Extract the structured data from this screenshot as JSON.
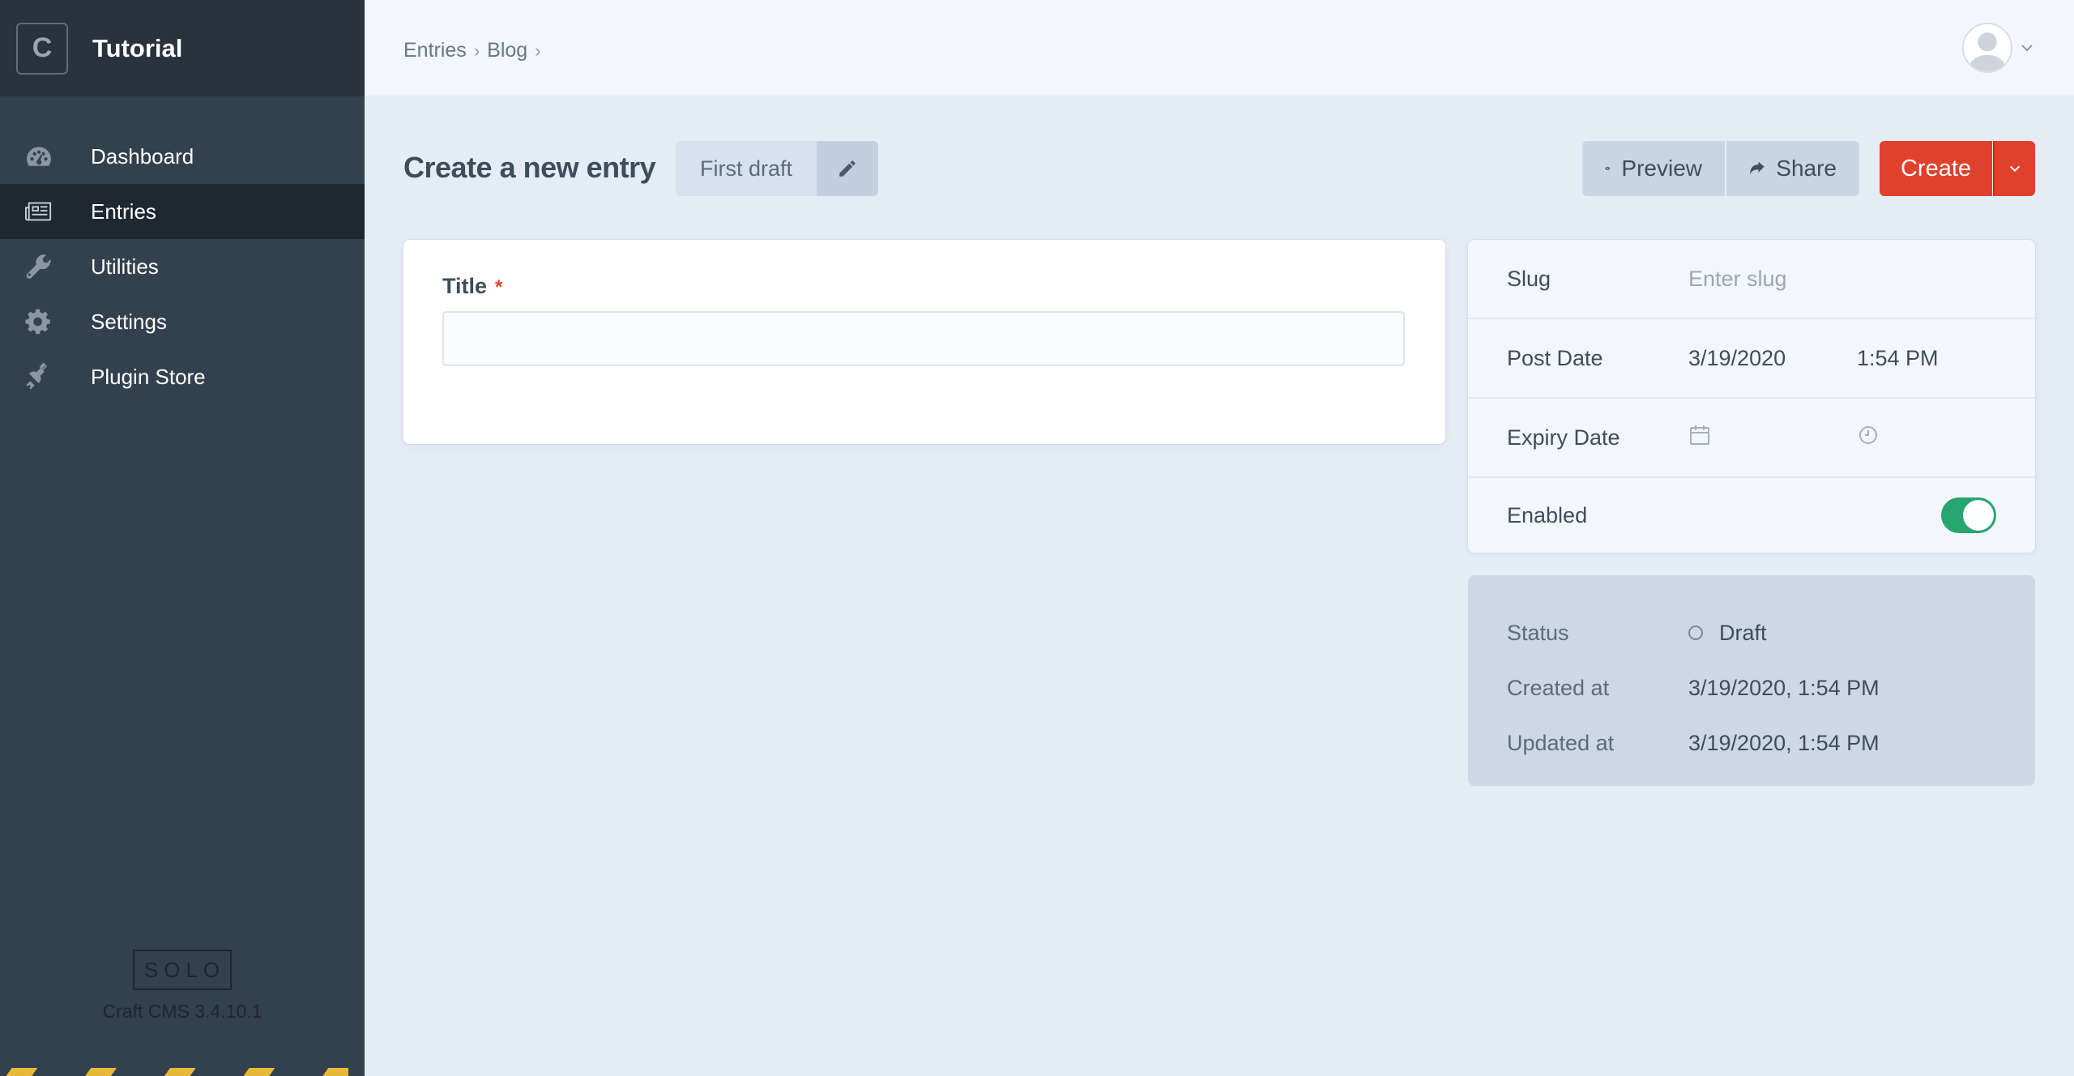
{
  "site": {
    "logo_letter": "C",
    "name": "Tutorial"
  },
  "nav": {
    "items": [
      {
        "label": "Dashboard",
        "icon": "gauge-icon"
      },
      {
        "label": "Entries",
        "icon": "newspaper-icon",
        "active": true
      },
      {
        "label": "Utilities",
        "icon": "wrench-icon"
      },
      {
        "label": "Settings",
        "icon": "gear-icon"
      },
      {
        "label": "Plugin Store",
        "icon": "plug-icon"
      }
    ]
  },
  "footer": {
    "edition": "SOLO",
    "version": "Craft CMS 3.4.10.1"
  },
  "breadcrumb": [
    "Entries",
    "Blog"
  ],
  "page": {
    "title": "Create a new entry",
    "draft_name": "First draft"
  },
  "toolbar": {
    "preview_label": "Preview",
    "share_label": "Share",
    "create_label": "Create"
  },
  "form": {
    "title_label": "Title",
    "required_mark": "*",
    "title_value": ""
  },
  "meta": {
    "slug_label": "Slug",
    "slug_placeholder": "Enter slug",
    "post_date_label": "Post Date",
    "post_date": "3/19/2020",
    "post_time": "1:54 PM",
    "expiry_date_label": "Expiry Date",
    "enabled_label": "Enabled",
    "enabled": true
  },
  "info": {
    "status_label": "Status",
    "status_value": "Draft",
    "created_label": "Created at",
    "created_value": "3/19/2020, 1:54 PM",
    "updated_label": "Updated at",
    "updated_value": "3/19/2020, 1:54 PM"
  },
  "colors": {
    "sidebar": "#33404d",
    "accent_red": "#e0412d",
    "toggle_green": "#26a570",
    "background": "#e4ecf6"
  }
}
